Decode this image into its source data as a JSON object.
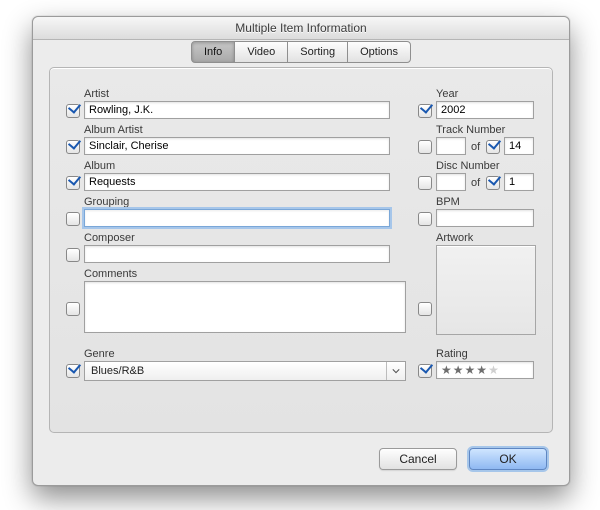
{
  "window": {
    "title": "Multiple Item Information"
  },
  "tabs": [
    "Info",
    "Video",
    "Sorting",
    "Options"
  ],
  "active_tab": "Info",
  "fields": {
    "artist": {
      "label": "Artist",
      "checked": true,
      "value": "Rowling, J.K."
    },
    "album_artist": {
      "label": "Album Artist",
      "checked": true,
      "value": "Sinclair, Cherise"
    },
    "album": {
      "label": "Album",
      "checked": true,
      "value": "Requests"
    },
    "grouping": {
      "label": "Grouping",
      "checked": false,
      "value": "",
      "focused": true
    },
    "composer": {
      "label": "Composer",
      "checked": false,
      "value": ""
    },
    "comments": {
      "label": "Comments",
      "checked": false,
      "value": ""
    },
    "genre": {
      "label": "Genre",
      "checked": true,
      "value": "Blues/R&B"
    },
    "year": {
      "label": "Year",
      "checked": true,
      "value": "2002"
    },
    "track": {
      "label": "Track Number",
      "num_checked": false,
      "num": "",
      "of": "of",
      "total_checked": true,
      "total": "14"
    },
    "disc": {
      "label": "Disc Number",
      "num_checked": false,
      "num": "",
      "of": "of",
      "total_checked": true,
      "total": "1"
    },
    "bpm": {
      "label": "BPM",
      "checked": false,
      "value": ""
    },
    "artwork": {
      "label": "Artwork",
      "checked": false
    },
    "rating": {
      "label": "Rating",
      "checked": true,
      "stars": 4,
      "max": 5
    }
  },
  "buttons": {
    "cancel": "Cancel",
    "ok": "OK"
  }
}
